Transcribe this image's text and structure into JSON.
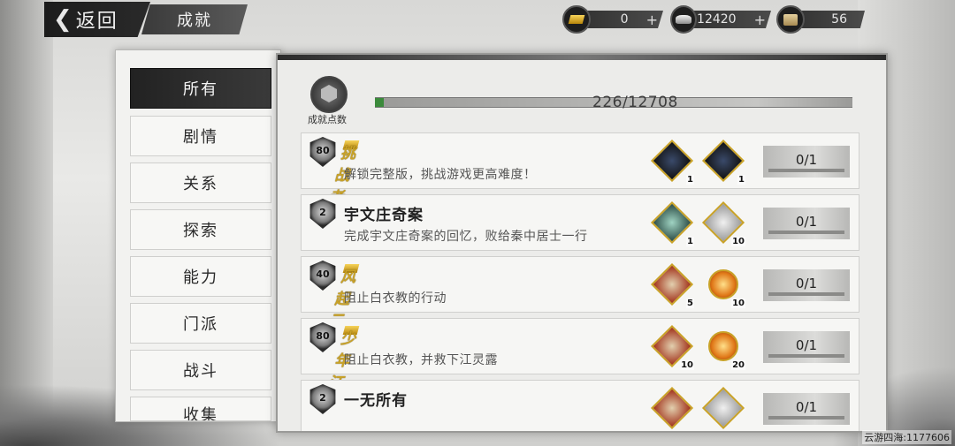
{
  "header": {
    "back_label": "返回",
    "title": "成就"
  },
  "currencies": [
    {
      "icon": "gold-ingot-icon",
      "value": "0",
      "plus": "+"
    },
    {
      "icon": "silver-ingot-icon",
      "value": "12420",
      "plus": "+"
    },
    {
      "icon": "scroll-icon",
      "value": "56"
    }
  ],
  "sidebar": {
    "items": [
      {
        "label": "所有",
        "active": true
      },
      {
        "label": "剧情"
      },
      {
        "label": "关系"
      },
      {
        "label": "探索"
      },
      {
        "label": "能力"
      },
      {
        "label": "门派"
      },
      {
        "label": "战斗"
      },
      {
        "label": "收集"
      }
    ]
  },
  "points": {
    "label": "成就点数",
    "text": "226/12708",
    "current": 226,
    "total": 12708
  },
  "achievements": [
    {
      "level": "80",
      "title": "挑战者",
      "highlight": true,
      "desc": "解锁完整版，挑战游戏更高难度！",
      "rewards": [
        {
          "icon": "warrior-figure-icon",
          "count": "1"
        },
        {
          "icon": "warrior-figure-icon",
          "count": "1"
        }
      ],
      "progress": "0/1"
    },
    {
      "level": "2",
      "title": "宇文庄奇案",
      "highlight": false,
      "desc": "完成宇文庄奇案的回忆，败给秦中居士一行",
      "rewards": [
        {
          "icon": "gem-icon",
          "count": "1"
        },
        {
          "icon": "silver-icon",
          "count": "10"
        }
      ],
      "progress": "0/1"
    },
    {
      "level": "40",
      "title": "风起云涌",
      "highlight": true,
      "desc": "阻止白衣教的行动",
      "rewards": [
        {
          "icon": "pot-icon",
          "count": "5"
        },
        {
          "icon": "fire-orb-icon",
          "count": "10"
        }
      ],
      "progress": "0/1"
    },
    {
      "level": "80",
      "title": "少年江湖梦",
      "highlight": true,
      "desc": "阻止白衣教，并救下江灵露",
      "rewards": [
        {
          "icon": "pot-icon",
          "count": "10"
        },
        {
          "icon": "fire-orb-icon",
          "count": "20"
        }
      ],
      "progress": "0/1"
    },
    {
      "level": "2",
      "title": "一无所有",
      "highlight": false,
      "desc": "",
      "rewards": [
        {
          "icon": "pot-icon",
          "count": ""
        },
        {
          "icon": "silver-icon",
          "count": ""
        }
      ],
      "progress": "0/1"
    }
  ],
  "watermark": "云游四海:1177606",
  "colors": {
    "accent_gold": "#c9a227",
    "progress_green": "#3b8a3b"
  }
}
